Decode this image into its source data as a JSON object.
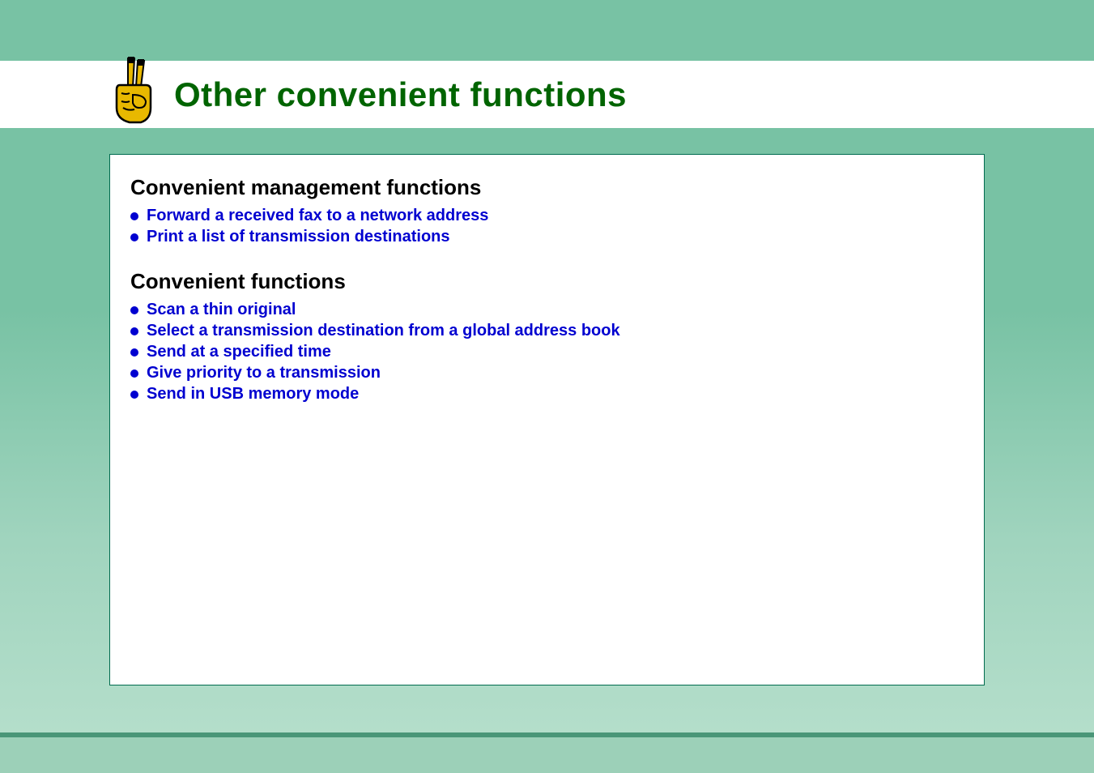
{
  "title": "Other convenient functions",
  "sections": [
    {
      "heading": "Convenient management functions",
      "links": [
        "Forward a received fax to a network address",
        "Print a list of transmission destinations"
      ]
    },
    {
      "heading": "Convenient functions",
      "links": [
        "Scan a thin original",
        "Select a transmission destination from a global address book",
        "Send at a specified time",
        "Give priority to a transmission",
        "Send in USB memory mode"
      ]
    }
  ]
}
